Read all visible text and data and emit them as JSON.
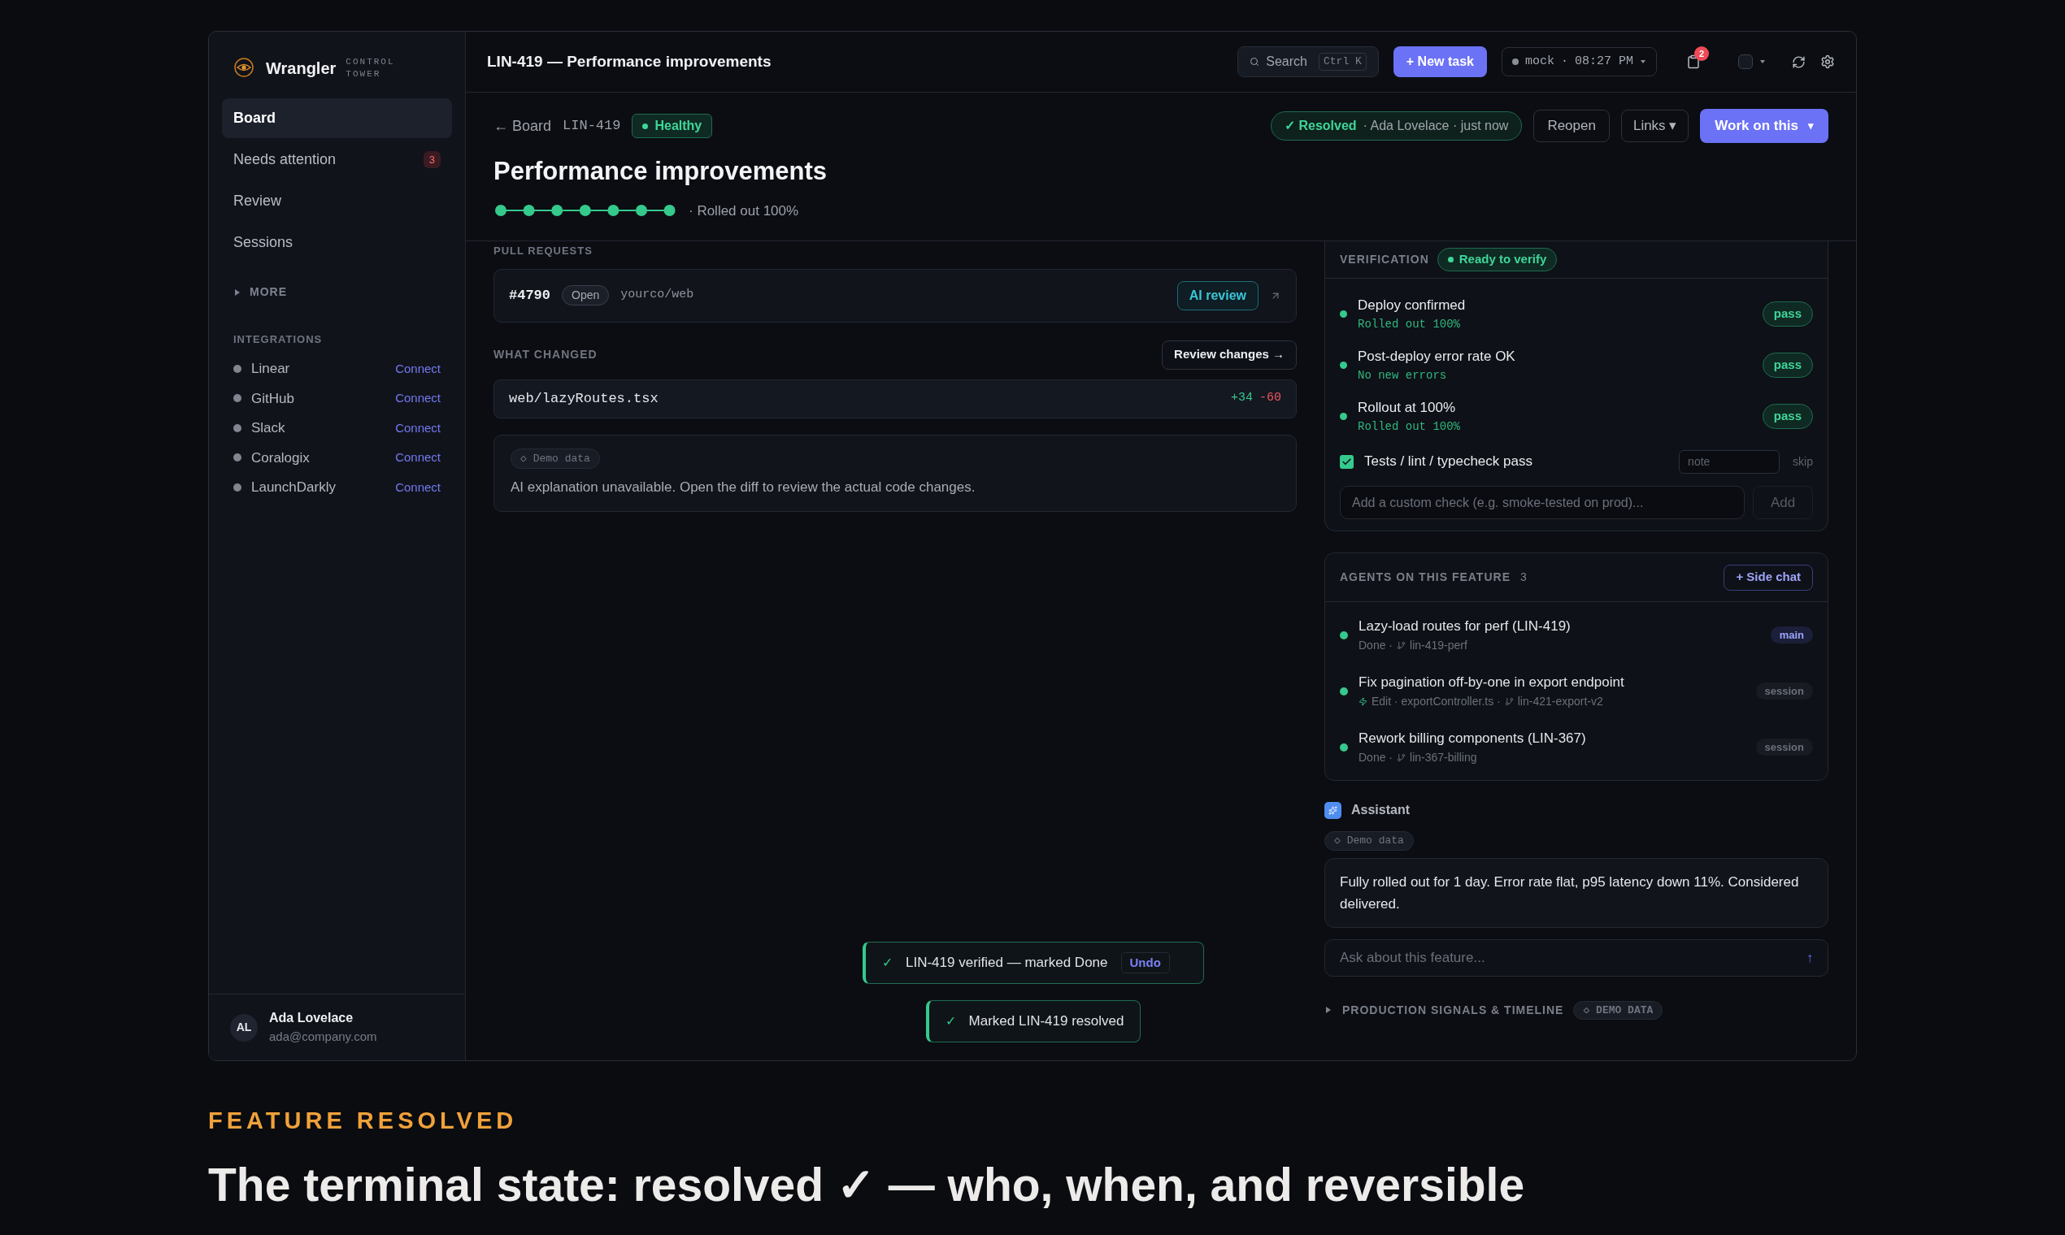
{
  "sidebar": {
    "brand": {
      "name": "Wrangler",
      "tagline": "CONTROL TOWER"
    },
    "nav": [
      {
        "label": "Board",
        "selected": true
      },
      {
        "label": "Needs attention",
        "selected": false,
        "badge": "3"
      },
      {
        "label": "Review",
        "selected": false
      },
      {
        "label": "Sessions",
        "selected": false
      }
    ],
    "more": {
      "label": "MORE",
      "expanded": false
    },
    "integrations": {
      "title": "INTEGRATIONS",
      "items": [
        {
          "name": "Linear",
          "action": "Connect"
        },
        {
          "name": "GitHub",
          "action": "Connect"
        },
        {
          "name": "Slack",
          "action": "Connect"
        },
        {
          "name": "Coralogix",
          "action": "Connect"
        },
        {
          "name": "LaunchDarkly",
          "action": "Connect"
        }
      ]
    },
    "user": {
      "initials": "AL",
      "name": "Ada Lovelace",
      "email": "ada@company.com"
    }
  },
  "topbar": {
    "title": "LIN-419 — Performance improvements",
    "search": {
      "placeholder": "Search",
      "shortcut": "Ctrl K"
    },
    "new_task": "+ New task",
    "env": {
      "label": "mock",
      "separator": "·",
      "time": "08:27 PM"
    },
    "notifications": "2"
  },
  "feature": {
    "back": "← Board",
    "id": "LIN-419",
    "health": "Healthy",
    "status": {
      "label": "✓ Resolved",
      "detail": "· Ada Lovelace · just now"
    },
    "reopen": "Reopen",
    "links": "Links ▾",
    "work": "Work on this",
    "work_caret": "▾",
    "title": "Performance improvements",
    "steps": [
      {
        "done": true
      },
      {
        "done": true
      },
      {
        "done": true
      },
      {
        "done": true
      },
      {
        "done": true
      },
      {
        "done": true
      },
      {
        "done": true
      }
    ],
    "rollout": "· Rolled out 100%"
  },
  "pull_requests": {
    "title": "PULL REQUESTS",
    "items": [
      {
        "number": "#4790",
        "state": "Open",
        "repo": "yourco/web",
        "action": "AI review"
      }
    ]
  },
  "what_changed": {
    "title": "WHAT CHANGED",
    "action": "Review changes →",
    "files": [
      {
        "path": "web/lazyRoutes.tsx",
        "added": "+34",
        "removed": "-60"
      }
    ],
    "demo_tag": "◇ Demo data",
    "explanation": "AI explanation unavailable. Open the diff to review the actual code changes."
  },
  "verification": {
    "title": "VERIFICATION",
    "status": "Ready to verify",
    "checks": [
      {
        "kind": "auto",
        "label": "Deploy confirmed",
        "detail": "Rolled out 100%",
        "result": "pass"
      },
      {
        "kind": "auto",
        "label": "Post-deploy error rate OK",
        "detail": "No new errors",
        "result": "pass"
      },
      {
        "kind": "auto",
        "label": "Rollout at 100%",
        "detail": "Rolled out 100%",
        "result": "pass"
      },
      {
        "kind": "manual",
        "label": "Tests / lint / typecheck pass",
        "checked": true,
        "note_placeholder": "note",
        "skip": "skip"
      }
    ],
    "custom": {
      "placeholder": "Add a custom check (e.g. smoke-tested on prod)...",
      "button": "Add"
    }
  },
  "agents": {
    "title": "AGENTS ON THIS FEATURE",
    "count": "3",
    "action": "+ Side chat",
    "items": [
      {
        "title": "Lazy-load routes for perf (LIN-419)",
        "bolt": false,
        "activity": "Done ·",
        "branch": "lin-419-perf",
        "tag": {
          "label": "main",
          "kind": "main"
        }
      },
      {
        "title": "Fix pagination off-by-one in export endpoint",
        "bolt": true,
        "activity": "Edit · exportController.ts ·",
        "branch": "lin-421-export-v2",
        "tag": {
          "label": "session",
          "kind": "session"
        }
      },
      {
        "title": "Rework billing components (LIN-367)",
        "bolt": false,
        "activity": "Done ·",
        "branch": "lin-367-billing",
        "tag": {
          "label": "session",
          "kind": "session"
        }
      }
    ]
  },
  "assistant": {
    "title": "Assistant",
    "demo_tag": "◇ Demo data",
    "message": "Fully rolled out for 1 day. Error rate flat, p95 latency down 11%. Considered delivered.",
    "input_placeholder": "Ask about this feature...",
    "send": "↑"
  },
  "signals": {
    "title": "PRODUCTION SIGNALS & TIMELINE",
    "expanded": false,
    "tag": "◇ DEMO DATA"
  },
  "toasts": [
    {
      "icon": "✓",
      "message": "LIN-419 verified — marked Done",
      "action": "Undo"
    },
    {
      "icon": "✓",
      "message": "Marked LIN-419 resolved"
    }
  ],
  "caption": {
    "eyebrow": "FEATURE RESOLVED",
    "headline": "The terminal state: resolved ✓ — who, when, and reversible"
  }
}
